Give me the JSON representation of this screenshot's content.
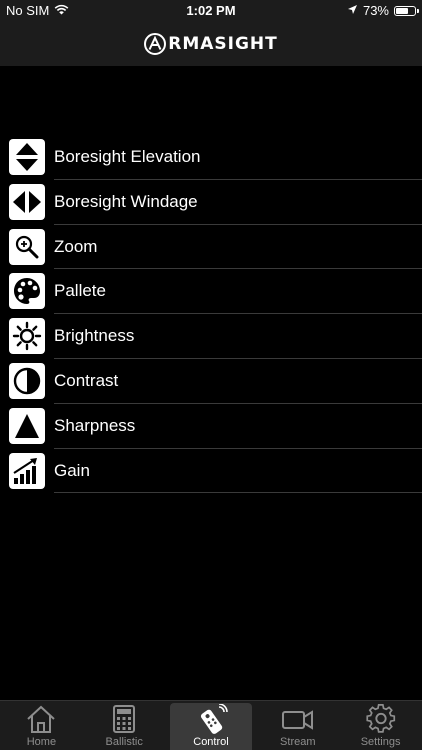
{
  "status_bar": {
    "carrier": "No SIM",
    "time": "1:02 PM",
    "battery": "73%",
    "battery_level": 0.73
  },
  "header": {
    "logo_text": "RMASIGHT"
  },
  "control_list": [
    {
      "label": "Boresight Elevation",
      "icon": "up-down-arrows-icon"
    },
    {
      "label": "Boresight Windage",
      "icon": "left-right-arrows-icon"
    },
    {
      "label": "Zoom",
      "icon": "magnifier-icon"
    },
    {
      "label": "Pallete",
      "icon": "palette-icon"
    },
    {
      "label": "Brightness",
      "icon": "sun-icon"
    },
    {
      "label": "Contrast",
      "icon": "contrast-icon"
    },
    {
      "label": "Sharpness",
      "icon": "triangle-icon"
    },
    {
      "label": "Gain",
      "icon": "gain-bars-icon"
    }
  ],
  "tab_bar": {
    "active": "Control",
    "tabs": [
      {
        "label": "Home",
        "icon": "home-icon"
      },
      {
        "label": "Ballistic",
        "icon": "calculator-icon"
      },
      {
        "label": "Control",
        "icon": "remote-icon"
      },
      {
        "label": "Stream",
        "icon": "video-camera-icon"
      },
      {
        "label": "Settings",
        "icon": "gear-icon"
      }
    ]
  },
  "colors": {
    "background": "#000000",
    "bar": "#1c1c1c",
    "active_tab": "#3a3a3a",
    "inactive_tab_text": "#8e8e8e",
    "divider": "#3a3a3a"
  }
}
